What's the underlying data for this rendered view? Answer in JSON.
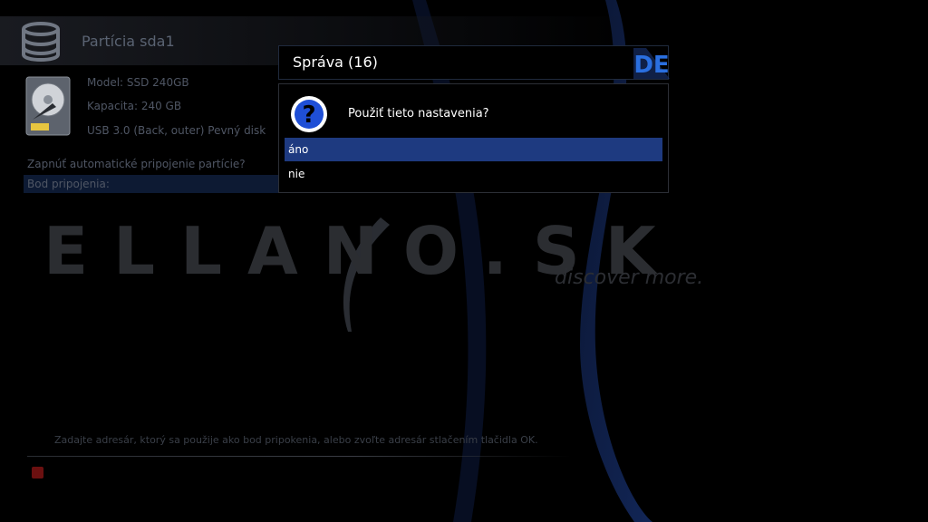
{
  "header": {
    "title": "Partícia sda1",
    "icon": "database-icon"
  },
  "device": {
    "icon": "hard-disk-icon",
    "model": "Model: SSD 240GB",
    "capacity": "Kapacita: 240 GB",
    "connection": "USB 3.0 (Back, outer) Pevný disk"
  },
  "settings": [
    {
      "label": "Zapnúť automatické pripojenie partície?"
    },
    {
      "label": "Bod pripojenia:"
    }
  ],
  "help": {
    "text": "Zadajte adresár, ktorý sa použije ako bod pripokenia, alebo zvoľte adresár stlačením tlačidla OK."
  },
  "background": {
    "watermark": "ELLANO.SK",
    "tagline": "discover more."
  },
  "dialog": {
    "title": "Správa (16)",
    "logo_text": "DE",
    "question": "Použiť tieto nastavenia?",
    "options": [
      {
        "label": "áno",
        "selected": true
      },
      {
        "label": "nie",
        "selected": false
      }
    ]
  },
  "colors": {
    "accent": "#1e3a80",
    "swoosh": "#0f1f44",
    "red_key": "#6b1010"
  }
}
